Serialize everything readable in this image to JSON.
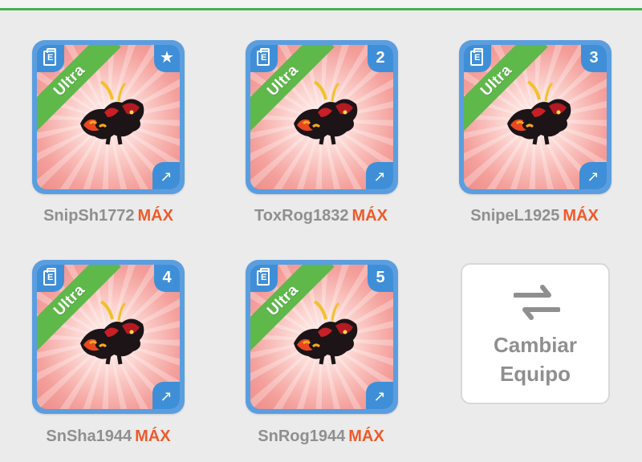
{
  "slots": [
    {
      "rarity": "Ultra",
      "badge": "★",
      "name": "SnipSh1772",
      "level": "MÁX"
    },
    {
      "rarity": "Ultra",
      "badge": "2",
      "name": "ToxRog1832",
      "level": "MÁX"
    },
    {
      "rarity": "Ultra",
      "badge": "3",
      "name": "SnipeL1925",
      "level": "MÁX"
    },
    {
      "rarity": "Ultra",
      "badge": "4",
      "name": "SnSha1944",
      "level": "MÁX"
    },
    {
      "rarity": "Ultra",
      "badge": "5",
      "name": "SnRog1944",
      "level": "MÁX"
    }
  ],
  "doc_letter": "E",
  "element_icon": "↗",
  "switch_team": {
    "line1": "Cambiar",
    "line2": "Equipo"
  },
  "colors": {
    "accent_green": "#4cae4f",
    "level_orange": "#ef5a2a",
    "card_blue": "#3f8fd8",
    "ribbon_green": "#5fb84a"
  },
  "icons": {
    "doc": "doc-icon",
    "element": "arrow-element-icon",
    "rank": "star-icon",
    "swap": "swap-arrows-icon"
  }
}
